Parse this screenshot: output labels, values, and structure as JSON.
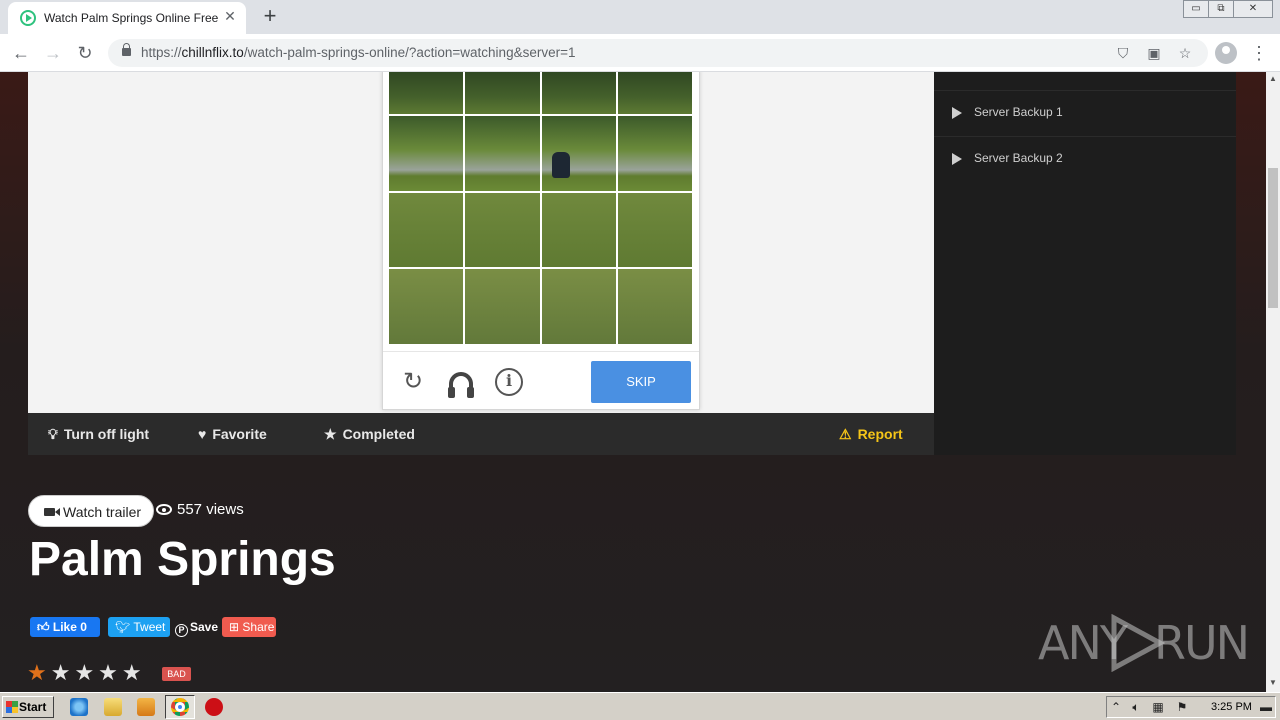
{
  "browser": {
    "tab_title": "Watch Palm Springs Online Free GoM",
    "tab_close": "✕",
    "new_tab": "+",
    "url_scheme": "https://",
    "url_host": "chillnflix.to",
    "url_path": "/watch-palm-springs-online/?action=watching&server=1",
    "window_controls": [
      "▭",
      "⧉",
      "✕"
    ]
  },
  "captcha": {
    "skip_label": "SKIP",
    "reload_icon": "↻",
    "info_icon": "i"
  },
  "action_bar": {
    "turn_off_light": "Turn off light",
    "favorite": "Favorite",
    "completed": "Completed",
    "report": "Report"
  },
  "servers": {
    "items": [
      {
        "label": "Server Backup 1"
      },
      {
        "label": "Server Backup 2"
      }
    ]
  },
  "movie": {
    "watch_trailer": "Watch trailer",
    "views": "557 views",
    "title": "Palm Springs",
    "rating_label": "BAD",
    "stars": "★★★★★",
    "rating": 1,
    "rating_max": 5
  },
  "social": {
    "like": "Like 0",
    "tweet": "Tweet",
    "save": "Save",
    "share": "Share"
  },
  "watermark": {
    "left": "ANY",
    "right": "RUN"
  },
  "taskbar": {
    "start": "Start",
    "clock": "3:25 PM"
  },
  "colors": {
    "accent_skip": "#4a90e2",
    "report": "#f5c518",
    "star_active": "#e0711b",
    "bad_badge": "#d9534f"
  }
}
